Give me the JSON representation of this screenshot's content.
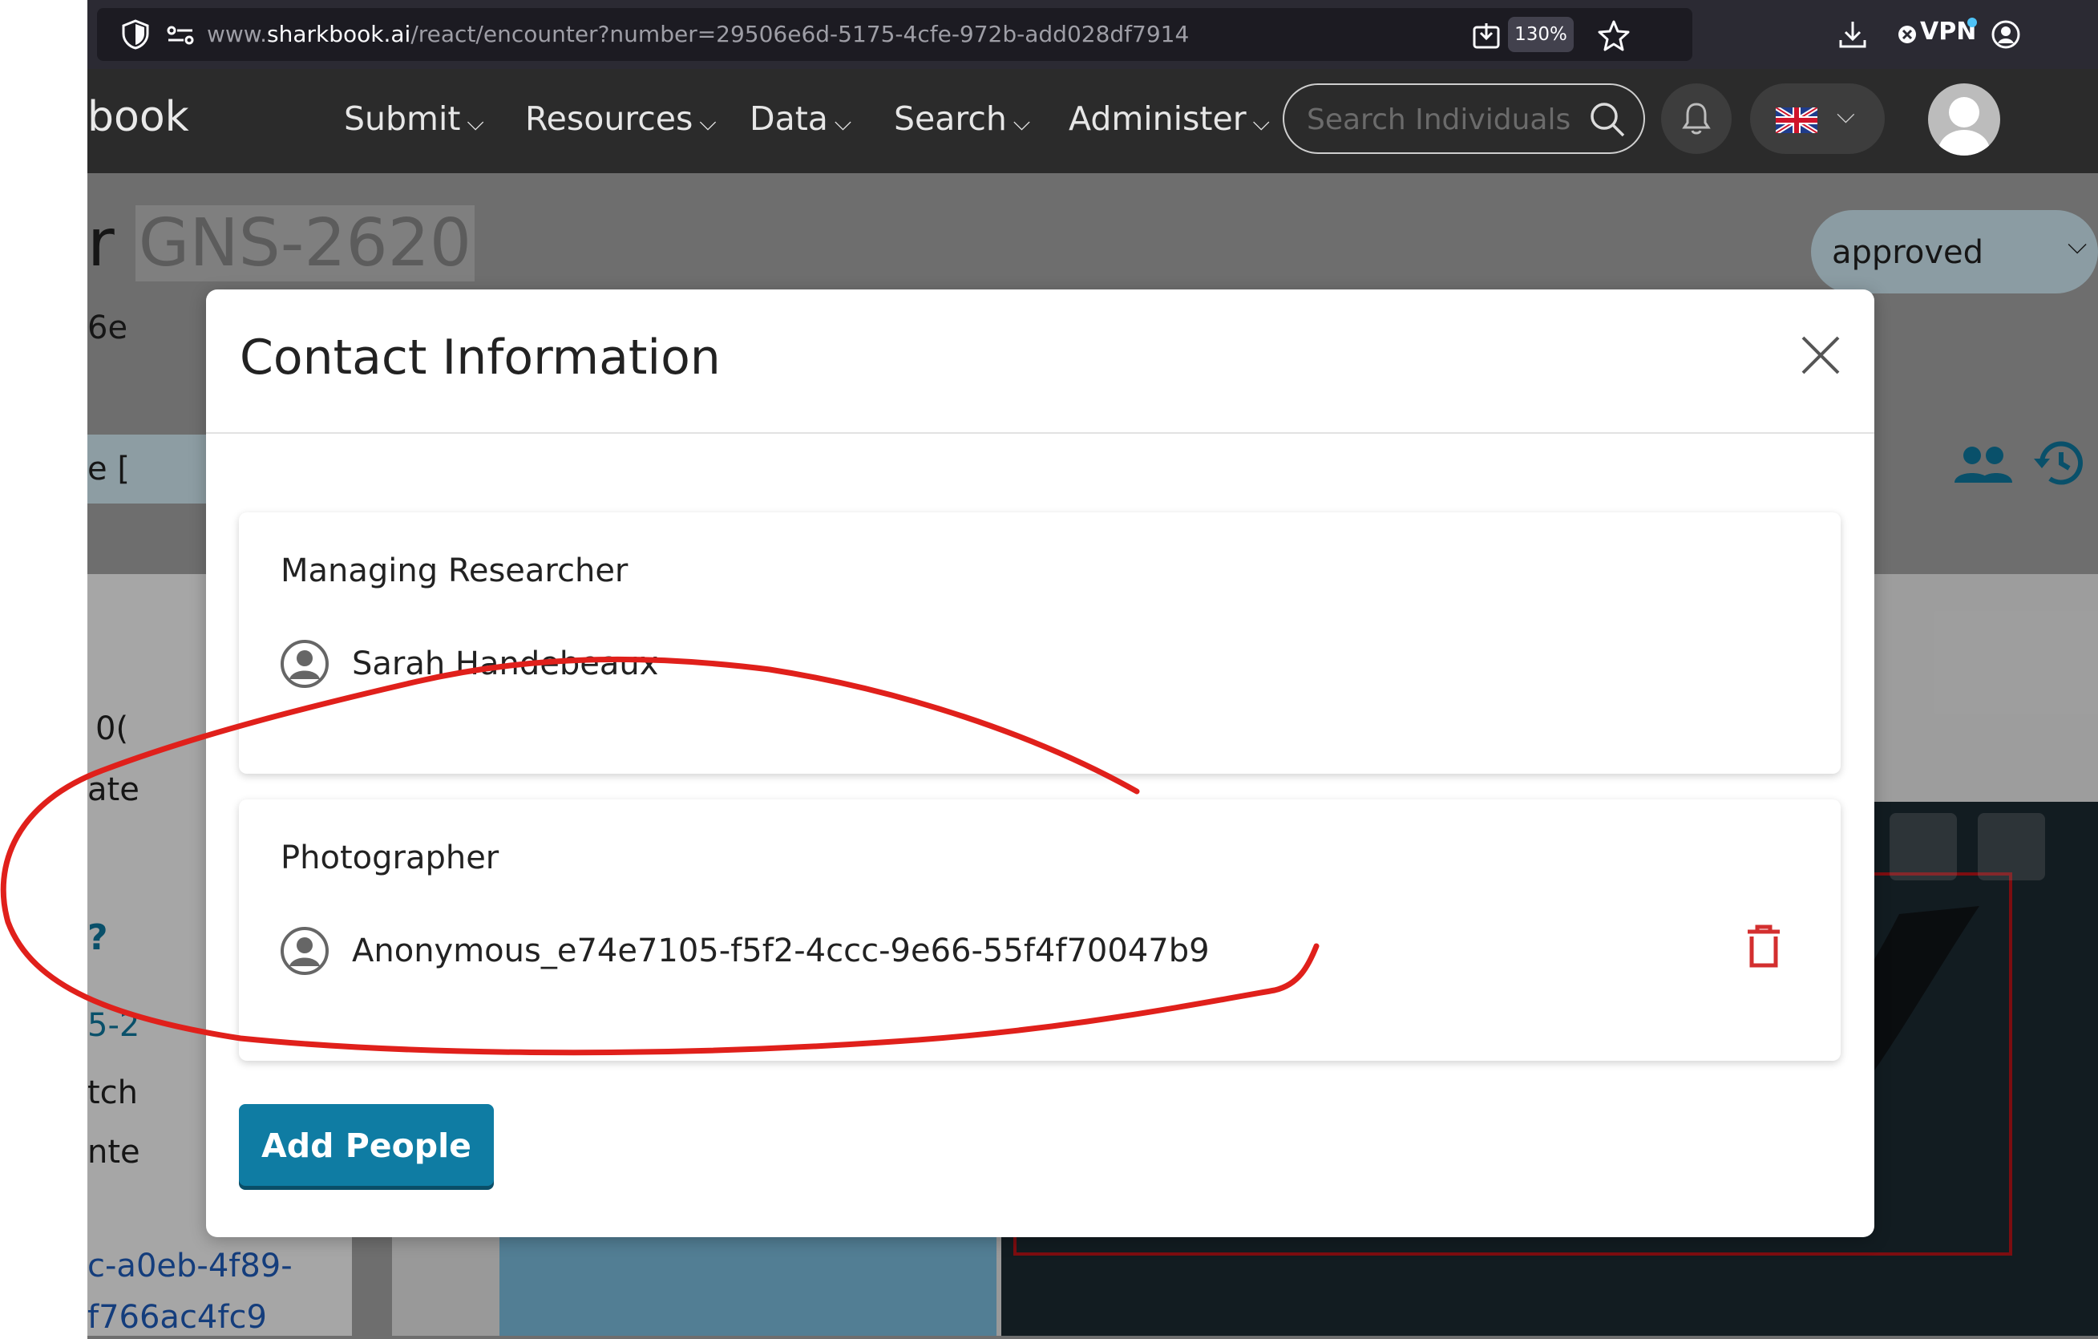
{
  "browser": {
    "url_prefix": "www.",
    "url_domain": "sharkbook.ai",
    "url_path": "/react/encounter?number=29506e6d-5175-4cfe-972b-add028df7914",
    "zoom": "130%",
    "vpn_label": "VPN"
  },
  "nav": {
    "brand": "book",
    "items": [
      {
        "label": "Submit"
      },
      {
        "label": "Resources"
      },
      {
        "label": "Data"
      },
      {
        "label": "Search"
      },
      {
        "label": "Administer"
      }
    ],
    "search_placeholder": "Search Individuals"
  },
  "page": {
    "title_prefix": "r",
    "title_id": "GNS-2620",
    "subtitle": "6e",
    "status_select": "approved",
    "tab_fragment": "e [",
    "side_fragments": [
      "0(",
      "ate",
      "?",
      "5-2",
      "tch",
      "nte"
    ],
    "bottom_link_1": "c-a0eb-4f89-",
    "bottom_link_2": "f766ac4fc9"
  },
  "modal": {
    "title": "Contact Information",
    "sections": [
      {
        "role": "Managing Researcher",
        "people": [
          {
            "name": "Sarah Handebeaux",
            "deletable": false
          }
        ]
      },
      {
        "role": "Photographer",
        "people": [
          {
            "name": "Anonymous_e74e7105-f5f2-4ccc-9e66-55f4f70047b9",
            "deletable": true
          }
        ]
      }
    ],
    "add_button": "Add People"
  },
  "colors": {
    "accent": "#0f7ca3",
    "delete": "#d32f2f",
    "annotation": "#e0201b",
    "navbar": "#2b2b2b"
  }
}
